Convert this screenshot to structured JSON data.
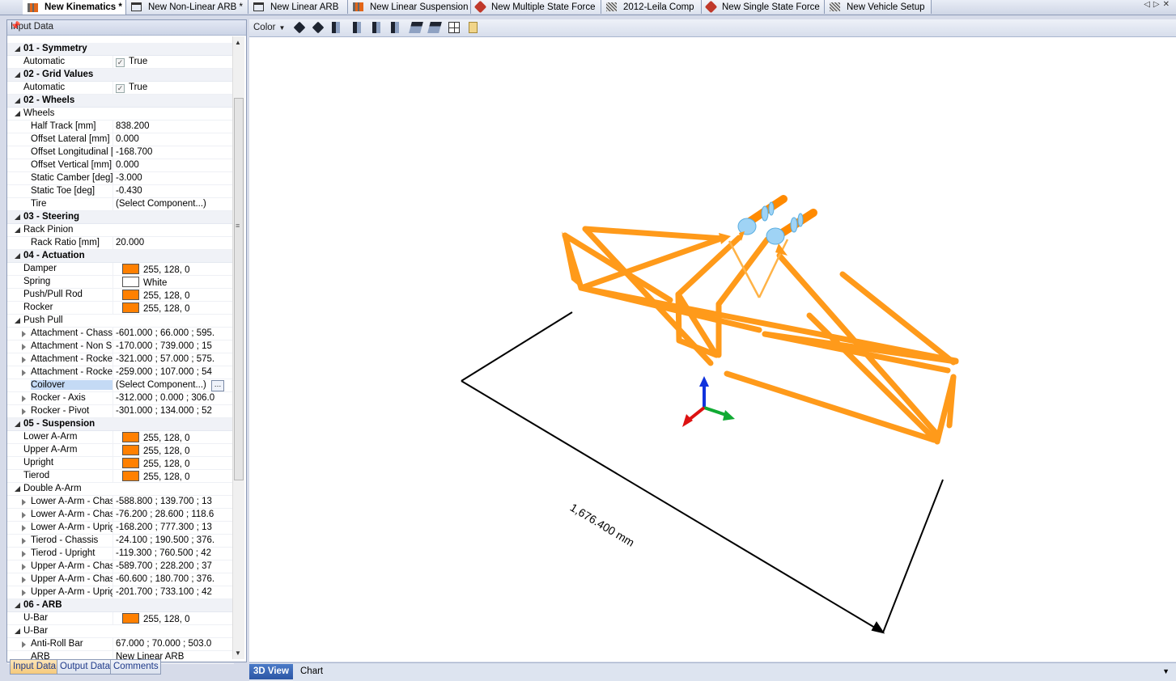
{
  "tabs": [
    {
      "label": "New Kinematics *",
      "icon": "coil-spring-icon"
    },
    {
      "label": "New Non-Linear ARB *",
      "icon": "window-icon"
    },
    {
      "label": "New Linear ARB",
      "icon": "window-icon"
    },
    {
      "label": "New Linear Suspension",
      "icon": "coil-spring-icon"
    },
    {
      "label": "New Multiple State Force",
      "icon": "force-icon"
    },
    {
      "label": "2012-Leila Comp",
      "icon": "car-icon"
    },
    {
      "label": "New Single State Force",
      "icon": "force-icon"
    },
    {
      "label": "New Vehicle Setup",
      "icon": "car-icon"
    }
  ],
  "left_panel": {
    "title": "Input Data",
    "rows": [
      {
        "type": "cat",
        "name": "01 - Symmetry"
      },
      {
        "name": "Automatic",
        "value": "True",
        "check": true
      },
      {
        "type": "cat",
        "name": "02 - Grid Values"
      },
      {
        "name": "Automatic",
        "value": "True",
        "check": true
      },
      {
        "type": "cat",
        "name": "02 - Wheels"
      },
      {
        "type": "group",
        "name": "Wheels"
      },
      {
        "name": "Half Track [mm]",
        "value": "838.200",
        "indent": 1
      },
      {
        "name": "Offset Lateral [mm]",
        "value": "0.000",
        "indent": 1
      },
      {
        "name": "Offset Longitudinal [",
        "value": "-168.700",
        "indent": 1
      },
      {
        "name": "Offset Vertical [mm]",
        "value": "0.000",
        "indent": 1
      },
      {
        "name": "Static Camber [deg]",
        "value": "-3.000",
        "indent": 1
      },
      {
        "name": "Static Toe [deg]",
        "value": "-0.430",
        "indent": 1
      },
      {
        "name": "Tire",
        "value": "(Select Component...)",
        "indent": 1
      },
      {
        "type": "cat",
        "name": "03 - Steering"
      },
      {
        "type": "group",
        "name": "Rack Pinion"
      },
      {
        "name": "Rack Ratio [mm]",
        "value": "20.000",
        "indent": 1
      },
      {
        "type": "cat",
        "name": "04 - Actuation"
      },
      {
        "name": "Damper",
        "value": "255, 128, 0",
        "swatch": "#ff8000"
      },
      {
        "name": "Spring",
        "value": "White",
        "swatch": "#ffffff"
      },
      {
        "name": "Push/Pull Rod",
        "value": "255, 128, 0",
        "swatch": "#ff8000"
      },
      {
        "name": "Rocker",
        "value": "255, 128, 0",
        "swatch": "#ff8000"
      },
      {
        "type": "group",
        "name": "Push Pull"
      },
      {
        "name": "Attachment - Chassi",
        "value": "-601.000 ; 66.000 ; 595.",
        "indent": 1,
        "expander": true
      },
      {
        "name": "Attachment - Non S",
        "value": "-170.000 ; 739.000 ; 15",
        "indent": 1,
        "expander": true
      },
      {
        "name": "Attachment - Rocker",
        "value": "-321.000 ; 57.000 ; 575.",
        "indent": 1,
        "expander": true
      },
      {
        "name": "Attachment - Rocker",
        "value": "-259.000 ; 107.000 ; 54",
        "indent": 1,
        "expander": true
      },
      {
        "name": "Coilover",
        "value": "(Select Component...)",
        "indent": 1,
        "selected": true,
        "ellipsis": true
      },
      {
        "name": "Rocker - Axis",
        "value": "-312.000 ; 0.000 ; 306.0",
        "indent": 1,
        "expander": true
      },
      {
        "name": "Rocker - Pivot",
        "value": "-301.000 ; 134.000 ; 52",
        "indent": 1,
        "expander": true
      },
      {
        "type": "cat",
        "name": "05 - Suspension"
      },
      {
        "name": "Lower A-Arm",
        "value": "255, 128, 0",
        "swatch": "#ff8000"
      },
      {
        "name": "Upper A-Arm",
        "value": "255, 128, 0",
        "swatch": "#ff8000"
      },
      {
        "name": "Upright",
        "value": "255, 128, 0",
        "swatch": "#ff8000"
      },
      {
        "name": "Tierod",
        "value": "255, 128, 0",
        "swatch": "#ff8000"
      },
      {
        "type": "group",
        "name": "Double A-Arm"
      },
      {
        "name": "Lower A-Arm - Chas",
        "value": "-588.800 ; 139.700 ; 13",
        "indent": 1,
        "expander": true
      },
      {
        "name": "Lower A-Arm - Chas",
        "value": "-76.200 ; 28.600 ; 118.6",
        "indent": 1,
        "expander": true
      },
      {
        "name": "Lower A-Arm - Uprig",
        "value": "-168.200 ; 777.300 ; 13",
        "indent": 1,
        "expander": true
      },
      {
        "name": "Tierod - Chassis",
        "value": "-24.100 ; 190.500 ; 376.",
        "indent": 1,
        "expander": true
      },
      {
        "name": "Tierod - Upright",
        "value": "-119.300 ; 760.500 ; 42",
        "indent": 1,
        "expander": true
      },
      {
        "name": "Upper A-Arm - Chas",
        "value": "-589.700 ; 228.200 ; 37",
        "indent": 1,
        "expander": true
      },
      {
        "name": "Upper A-Arm - Chas",
        "value": "-60.600 ; 180.700 ; 376.",
        "indent": 1,
        "expander": true
      },
      {
        "name": "Upper A-Arm - Uprig",
        "value": "-201.700 ; 733.100 ; 42",
        "indent": 1,
        "expander": true
      },
      {
        "type": "cat",
        "name": "06 - ARB"
      },
      {
        "name": "U-Bar",
        "value": "255, 128, 0",
        "swatch": "#ff8000"
      },
      {
        "type": "group",
        "name": "U-Bar"
      },
      {
        "name": "Anti-Roll Bar",
        "value": "67.000 ; 70.000 ; 503.0",
        "indent": 1,
        "expander": true
      },
      {
        "name": "ARB",
        "value": "New Linear ARB",
        "indent": 1
      }
    ]
  },
  "bottom_tabs": [
    "Input Data",
    "Output Data",
    "Comments"
  ],
  "toolbar": {
    "color_label": "Color"
  },
  "view": {
    "dimension_label": "1,676.400 mm"
  },
  "view_tabs": [
    "3D View",
    "Chart"
  ],
  "colors": {
    "member": "#ff9a1a",
    "spring": "#9fd3f5",
    "axis_x": "#dd1111",
    "axis_y": "#11aa33",
    "axis_z": "#1133dd",
    "accent_tab": "#2c56a5"
  }
}
